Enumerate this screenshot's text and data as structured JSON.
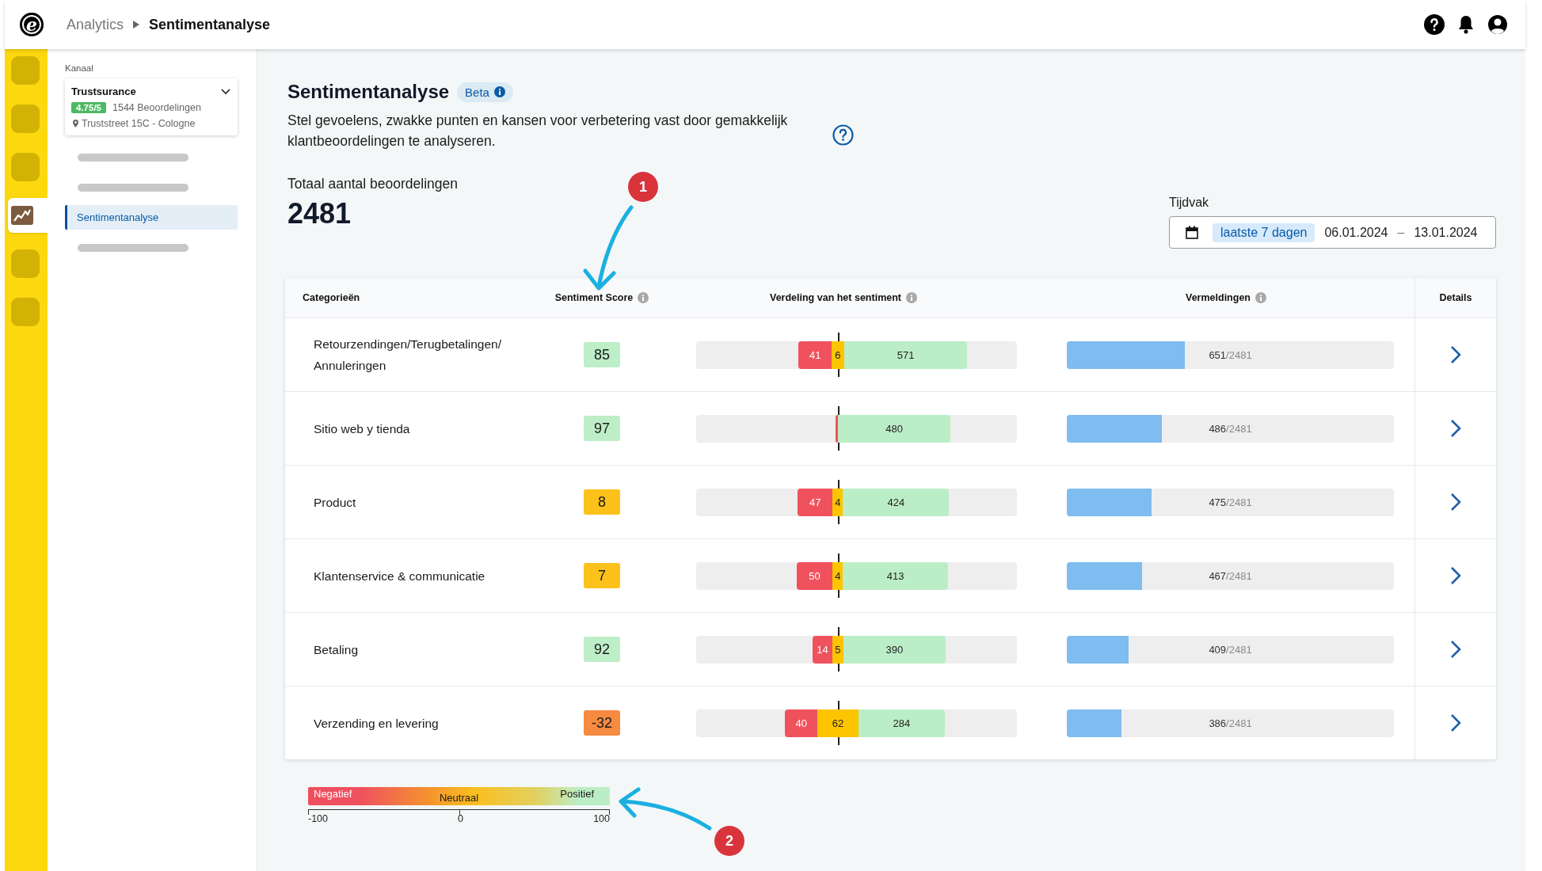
{
  "header": {
    "logo": "e",
    "breadcrumb": [
      {
        "label": "Analytics",
        "current": false
      },
      {
        "label": "Sentimentanalyse",
        "current": true
      }
    ]
  },
  "rail": {
    "items": [
      {
        "kind": "placeholder",
        "selected": false
      },
      {
        "kind": "placeholder",
        "selected": false
      },
      {
        "kind": "placeholder",
        "selected": false
      },
      {
        "kind": "chart",
        "selected": true
      },
      {
        "kind": "placeholder",
        "selected": false
      },
      {
        "kind": "placeholder",
        "selected": false
      }
    ]
  },
  "sidebar": {
    "channel_label": "Kanaal",
    "channel": {
      "name": "Trustsurance",
      "rating": "4.75/5",
      "reviews": "1544 Beoordelingen",
      "address": "Truststreet 15C - Cologne"
    },
    "items": [
      {
        "kind": "placeholder",
        "selected": false
      },
      {
        "kind": "placeholder",
        "selected": false
      },
      {
        "kind": "link",
        "label": "Sentimentanalyse",
        "selected": true
      },
      {
        "kind": "placeholder",
        "selected": false
      }
    ]
  },
  "page": {
    "title": "Sentimentanalyse",
    "badge": "Beta",
    "description": "Stel gevoelens, zwakke punten en kansen voor verbetering vast door gemakkelijk klantbeoordelingen te analyseren.",
    "total_label": "Totaal aantal beoordelingen",
    "total": "2481"
  },
  "period": {
    "label": "Tijdvak",
    "preset": "laatste 7 dagen",
    "from": "06.01.2024",
    "separator": "–",
    "to": "13.01.2024"
  },
  "table": {
    "columns": [
      {
        "label": "Categorieën",
        "info": false
      },
      {
        "label": "Sentiment Score",
        "info": true
      },
      {
        "label": "Verdeling van het sentiment",
        "info": true
      },
      {
        "label": "Vermeldingen",
        "info": true
      },
      {
        "label": "Details",
        "info": false
      }
    ],
    "rows": [
      {
        "category": "Retourzendingen/Terugbetalingen/ Annuleringen",
        "score": "85",
        "color": "#bdeec8",
        "segments": [
          {
            "kind": "negative",
            "label": "41"
          },
          {
            "kind": "neutral",
            "label": "6"
          },
          {
            "kind": "positive",
            "label": "571"
          }
        ],
        "mentions": {
          "count": "651",
          "total": "/2481",
          "level": 0.36
        }
      },
      {
        "category": "Sitio web y tienda",
        "score": "97",
        "color": "#bdeec8",
        "segments": [
          {
            "kind": "negative"
          },
          {
            "kind": "positive",
            "label": "480"
          }
        ],
        "mentions": {
          "count": "486",
          "total": "/2481",
          "level": 0.29
        }
      },
      {
        "category": "Product",
        "score": "8",
        "color": "#fcc21b",
        "segments": [
          {
            "kind": "negative",
            "label": "47"
          },
          {
            "kind": "neutral",
            "label": "4"
          },
          {
            "kind": "positive",
            "label": "424"
          }
        ],
        "mentions": {
          "count": "475",
          "total": "/2481",
          "level": 0.26
        }
      },
      {
        "category": "Klantenservice & communicatie",
        "score": "7",
        "color": "#fcc21b",
        "segments": [
          {
            "kind": "negative",
            "label": "50"
          },
          {
            "kind": "neutral",
            "label": "4"
          },
          {
            "kind": "positive",
            "label": "413"
          }
        ],
        "mentions": {
          "count": "467",
          "total": "/2481",
          "level": 0.23
        }
      },
      {
        "category": "Betaling",
        "score": "92",
        "color": "#bdeec8",
        "segments": [
          {
            "kind": "negative",
            "label": "14"
          },
          {
            "kind": "neutral",
            "label": "5"
          },
          {
            "kind": "positive",
            "label": "390"
          }
        ],
        "mentions": {
          "count": "409",
          "total": "/2481",
          "level": 0.19
        }
      },
      {
        "category": "Verzending en levering",
        "score": "-32",
        "color": "#f58a40",
        "segments": [
          {
            "kind": "negative",
            "label": "40"
          },
          {
            "kind": "neutral",
            "label": "62"
          },
          {
            "kind": "positive",
            "label": "284"
          }
        ],
        "mentions": {
          "count": "386",
          "total": "/2481",
          "level": 0.166
        }
      }
    ]
  },
  "legend": {
    "labels": [
      "Negatief",
      "Neutraal",
      "Positief"
    ],
    "ticks": [
      "-100",
      "0",
      "100"
    ]
  },
  "annotations": [
    {
      "label": "1",
      "kind": "down"
    },
    {
      "label": "2",
      "kind": "left"
    }
  ]
}
